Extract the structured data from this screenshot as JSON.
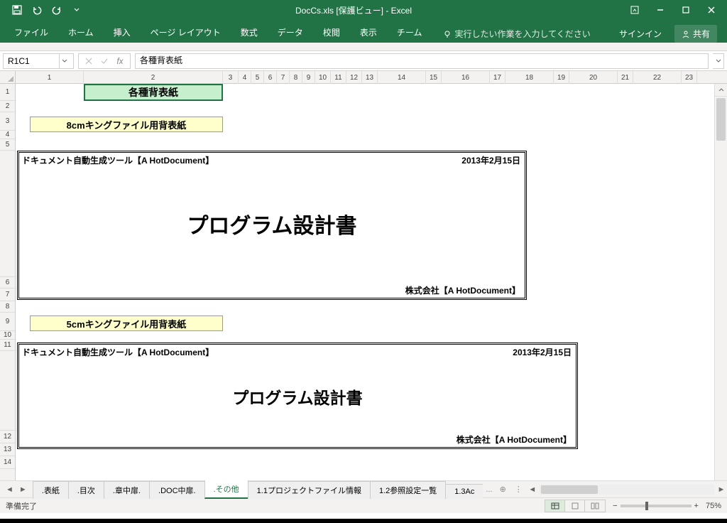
{
  "titlebar": {
    "title": "DocCs.xls [保護ビュー] - Excel"
  },
  "ribbon": {
    "tabs": [
      "ファイル",
      "ホーム",
      "挿入",
      "ページ レイアウト",
      "数式",
      "データ",
      "校閲",
      "表示",
      "チーム"
    ],
    "tell_me": "実行したい作業を入力してください",
    "signin": "サインイン",
    "share": "共有"
  },
  "formula": {
    "namebox": "R1C1",
    "value": "各種背表紙"
  },
  "columns_r1c1": [
    "1",
    "2",
    "3",
    "4",
    "5",
    "6",
    "7",
    "8",
    "9",
    "10",
    "11",
    "12",
    "13",
    "14",
    "15",
    "16",
    "17",
    "18",
    "19",
    "20",
    "21",
    "22",
    "23"
  ],
  "rows_visible": [
    "1",
    "2",
    "3",
    "4",
    "5",
    "",
    "6",
    "7",
    "8",
    "9",
    "10",
    "11",
    "",
    "12",
    "13",
    "14"
  ],
  "cells": {
    "a1": "各種背表紙",
    "label8cm": "8cmキングファイル用背表紙",
    "label5cm": "5cmキングファイル用背表紙"
  },
  "spine1": {
    "tool": "ドキュメント自動生成ツール【A HotDocument】",
    "date": "2013年2月15日",
    "title": "プログラム設計書",
    "company": "株式会社【A HotDocument】"
  },
  "spine2": {
    "tool": "ドキュメント自動生成ツール【A HotDocument】",
    "date": "2013年2月15日",
    "title": "プログラム設計書",
    "company": "株式会社【A HotDocument】"
  },
  "sheets": {
    "tabs": [
      ".表紙",
      ".目次",
      ".章中扉.",
      ".DOC中扉.",
      ".その他",
      "1.1プロジェクトファイル情報",
      "1.2参照設定一覧",
      "1.3Ac"
    ],
    "active_index": 4,
    "more": "..."
  },
  "statusbar": {
    "ready": "準備完了",
    "zoom": "75%"
  }
}
